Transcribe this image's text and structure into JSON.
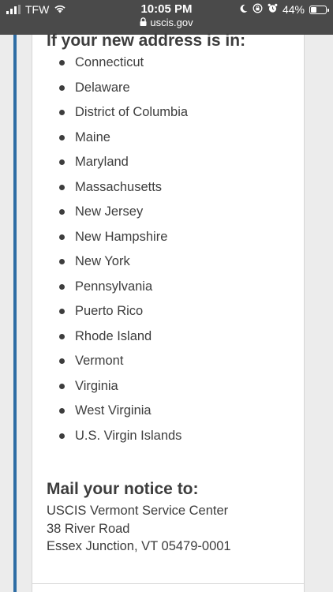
{
  "status_bar": {
    "carrier": "TFW",
    "time": "10:05 PM",
    "url": "uscis.gov",
    "battery_percent": "44%",
    "battery_level": 0.44,
    "icons": [
      "signal-icon",
      "wifi-icon",
      "lock-icon",
      "moon-icon",
      "orientation-lock-icon",
      "alarm-icon",
      "battery-icon"
    ]
  },
  "content": {
    "address_heading": "If your new address is in:",
    "states": [
      "Connecticut",
      "Delaware",
      "District of Columbia",
      "Maine",
      "Maryland",
      "Massachusetts",
      "New Jersey",
      "New Hampshire",
      "New York",
      "Pennsylvania",
      "Puerto Rico",
      "Rhode Island",
      "Vermont",
      "Virginia",
      "West Virginia",
      "U.S. Virgin Islands"
    ],
    "mail_heading": "Mail your notice to:",
    "mail_address": [
      "USCIS Vermont Service Center",
      "38 River Road",
      "Essex Junction, VT 05479-0001"
    ]
  },
  "colors": {
    "status_bar_bg": "#4a4a4a",
    "accent": "#2e6da4",
    "text": "#3d3d3d",
    "page_bg": "#ececec"
  }
}
